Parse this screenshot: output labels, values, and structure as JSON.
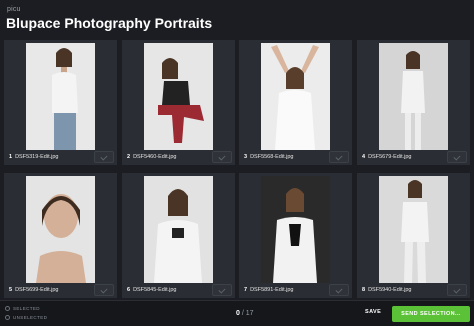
{
  "header": {
    "brand": "picu",
    "title": "Blupace Photography Portraits"
  },
  "photos": [
    {
      "number": "1",
      "filename": "DSF5319-Edit.jpg"
    },
    {
      "number": "2",
      "filename": "DSF5460-Edit.jpg"
    },
    {
      "number": "3",
      "filename": "DSF5568-Edit.jpg"
    },
    {
      "number": "4",
      "filename": "DSF5679-Edit.jpg"
    },
    {
      "number": "5",
      "filename": "DSF5699-Edit.jpg"
    },
    {
      "number": "6",
      "filename": "DSF5845-Edit.jpg"
    },
    {
      "number": "7",
      "filename": "DSF5891-Edit.jpg"
    },
    {
      "number": "8",
      "filename": "DSF5940-Edit.jpg"
    }
  ],
  "footer": {
    "filter_selected": "SELECTED",
    "filter_unselected": "UNSELECTED",
    "selected_count": "0",
    "total_count": "/ 17",
    "save_label": "SAVE",
    "send_label": "SEND SELECTION..."
  },
  "colors": {
    "background": "#1b1d22",
    "card": "#2a2d33",
    "send_button": "#5bc237"
  }
}
